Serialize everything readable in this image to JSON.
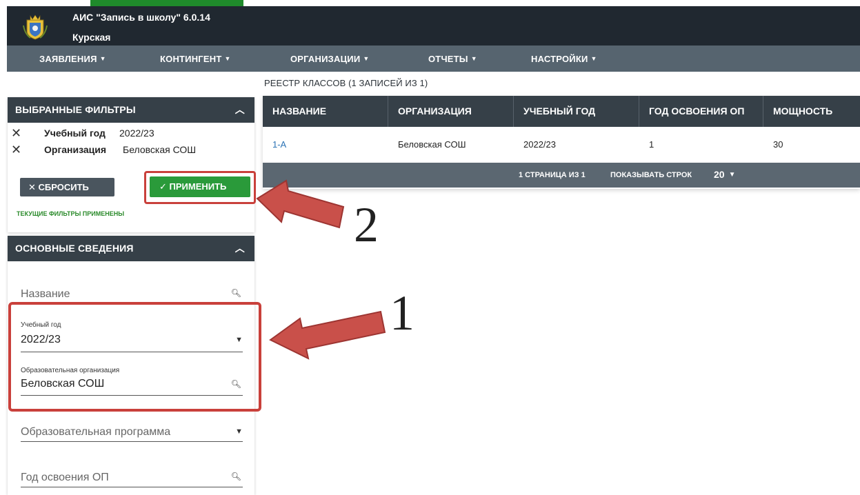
{
  "header": {
    "title": "АИС \"Запись в школу\" 6.0.14",
    "region": "Курская"
  },
  "nav": {
    "items": [
      {
        "label": "ЗАЯВЛЕНИЯ"
      },
      {
        "label": "КОНТИНГЕНТ"
      },
      {
        "label": "ОРГАНИЗАЦИИ"
      },
      {
        "label": "ОТЧЕТЫ"
      },
      {
        "label": "НАСТРОЙКИ"
      }
    ]
  },
  "registry": {
    "caption": "РЕЕСТР КЛАССОВ (1 ЗАПИСЕЙ ИЗ 1)",
    "columns": [
      "НАЗВАНИЕ",
      "ОРГАНИЗАЦИЯ",
      "УЧЕБНЫЙ ГОД",
      "ГОД ОСВОЕНИЯ ОП",
      "МОЩНОСТЬ"
    ],
    "rows": [
      {
        "name": "1-А",
        "organization": "Беловская СОШ",
        "year": "2022/23",
        "op_year": "1",
        "capacity": "30"
      }
    ],
    "pager": {
      "pages": "1 СТРАНИЦА ИЗ 1",
      "rows_label": "ПОКАЗЫВАТЬ СТРОК",
      "rows_value": "20"
    }
  },
  "filters": {
    "title": "ВЫБРАННЫЕ ФИЛЬТРЫ",
    "items": [
      {
        "name": "Учебный год",
        "value": "2022/23"
      },
      {
        "name": "Организация",
        "value": "Беловская СОШ"
      }
    ],
    "reset_label": "✕ СБРОСИТЬ",
    "apply_label": "✓ ПРИМЕНИТЬ",
    "status": "ТЕКУЩИЕ ФИЛЬТРЫ ПРИМЕНЕНЫ"
  },
  "main_info": {
    "title": "ОСНОВНЫЕ СВЕДЕНИЯ",
    "name_placeholder": "Название",
    "year_label": "Учебный год",
    "year_value": "2022/23",
    "org_label": "Образовательная организация",
    "org_value": "Беловская СОШ",
    "program_placeholder": "Образовательная программа",
    "op_year_placeholder": "Год освоения ОП"
  },
  "annotations": {
    "step1": "1",
    "step2": "2"
  },
  "colors": {
    "header_bg": "#202830",
    "nav_bg": "#56646f",
    "table_head_bg": "#364048",
    "apply_green": "#2a9a3a",
    "highlight_red": "#c9403b",
    "link_blue": "#2b73b5"
  },
  "icons": [
    "coat-of-arms-logo",
    "caret-down-icon",
    "chevron-up-icon",
    "close-icon",
    "check-icon",
    "search-icon",
    "arrow-annotation"
  ]
}
